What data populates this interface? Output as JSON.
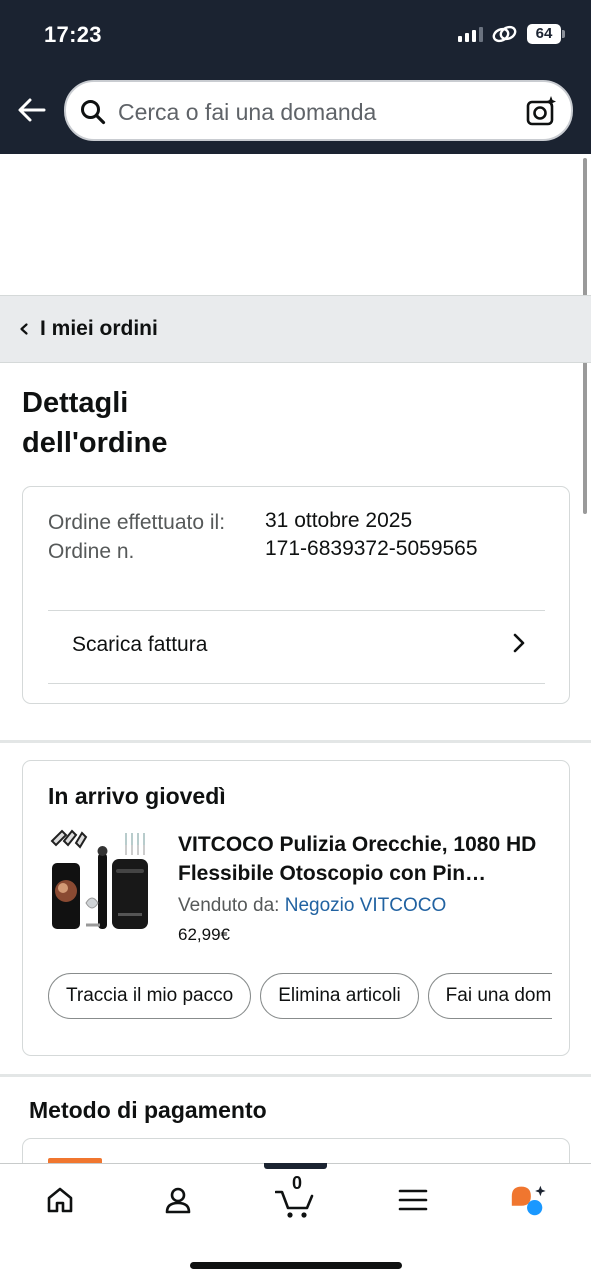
{
  "status_bar": {
    "time": "17:23",
    "battery": "64"
  },
  "search": {
    "placeholder": "Cerca o fai una domanda"
  },
  "breadcrumb": {
    "label": "I miei ordini"
  },
  "page": {
    "title": "Dettagli dell'ordine"
  },
  "order_info": {
    "placed_label": "Ordine effettuato il:",
    "number_label": "Ordine n.",
    "placed_value": "31 ottobre 2025",
    "number_value": "171-6839372-5059565",
    "invoice_label": "Scarica fattura"
  },
  "shipment": {
    "title": "In arrivo giovedì",
    "product_title": "VITCOCO Pulizia Orecchie, 1080 HD Flessibile Otoscopio con Pin…",
    "sold_by_label": "Venduto da:",
    "seller": "Negozio VITCOCO",
    "price": "62,99€",
    "actions": [
      "Traccia il mio pacco",
      "Elimina articoli",
      "Fai una domanda"
    ]
  },
  "payment": {
    "title": "Metodo di pagamento"
  },
  "tabbar": {
    "items": [
      "home-icon",
      "account-icon",
      "cart-icon",
      "menu-icon",
      "rufus-icon"
    ],
    "cart_count": "0",
    "accent": "#f0762f",
    "brand_dark": "#1b2331",
    "link_color": "#2162a1"
  }
}
